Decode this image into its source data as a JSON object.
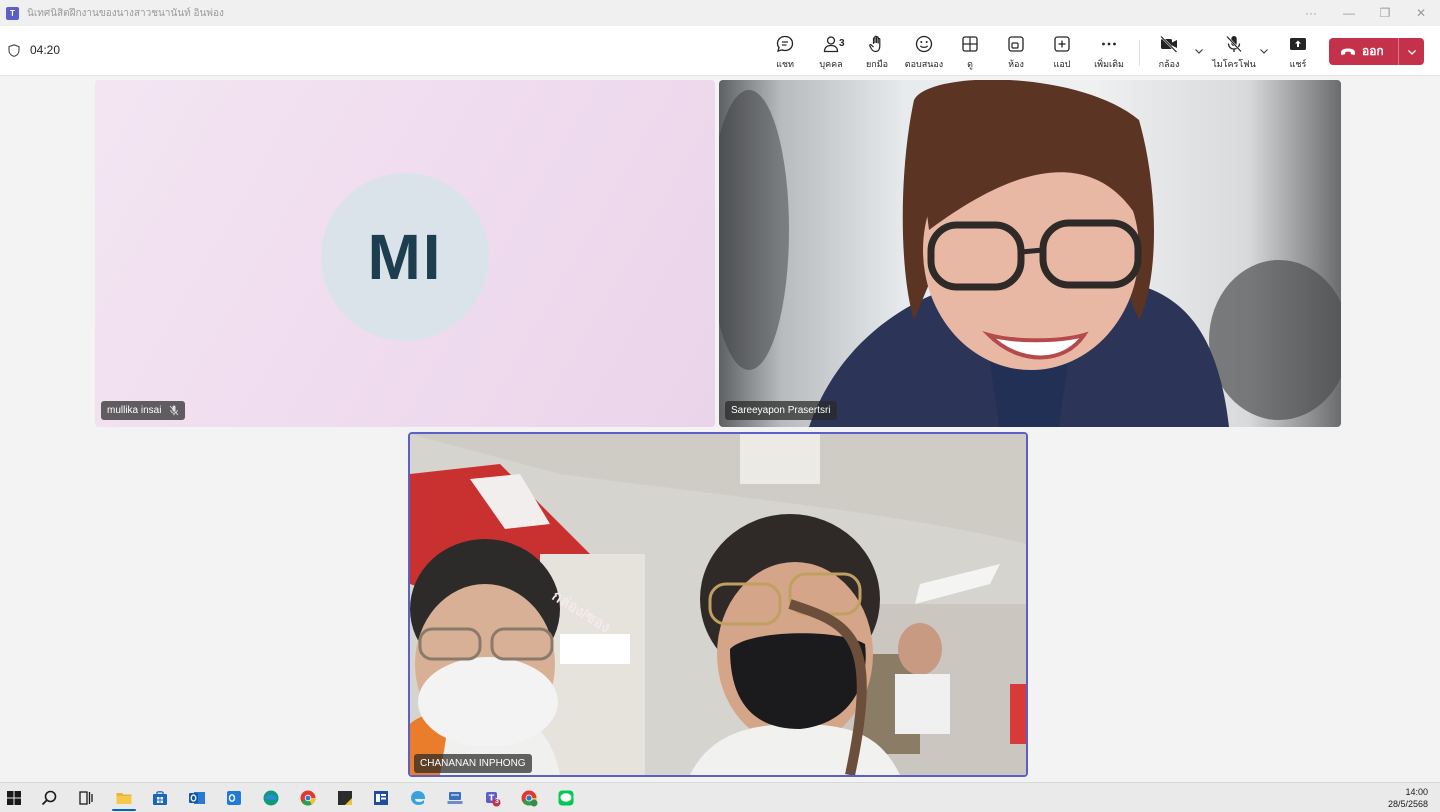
{
  "window": {
    "title": "นิเทศนิสิตฝึกงานของนางสาวชนานันท์ อินพ่อง",
    "controls": [
      "···",
      "—",
      "❐",
      "✕"
    ]
  },
  "meeting": {
    "timer": "04:20"
  },
  "toolbar": {
    "chat": {
      "label": "แชท",
      "icon": "chat-icon"
    },
    "people": {
      "label": "บุคคล",
      "count": "3",
      "icon": "people-icon"
    },
    "raise": {
      "label": "ยกมือ",
      "icon": "raise-hand-icon"
    },
    "react": {
      "label": "ตอบสนอง",
      "icon": "emoji-icon"
    },
    "view": {
      "label": "ดู",
      "icon": "grid-view-icon"
    },
    "rooms": {
      "label": "ห้อง",
      "icon": "rooms-icon"
    },
    "apps": {
      "label": "แอป",
      "icon": "add-app-icon"
    },
    "more": {
      "label": "เพิ่มเติม",
      "icon": "more-icon"
    },
    "camera": {
      "label": "กล้อง",
      "icon": "camera-off-icon"
    },
    "mic": {
      "label": "ไมโครโฟน",
      "icon": "mic-off-icon"
    },
    "share": {
      "label": "แชร์",
      "icon": "share-icon"
    },
    "leave": {
      "label": "ออก",
      "color": "#c4314b"
    }
  },
  "participants": [
    {
      "name": "mullika insai",
      "initials": "MI",
      "muted": true,
      "video": false
    },
    {
      "name": "Sareeyapon Prasertsri",
      "video": true
    },
    {
      "name": "CHANANAN INPHONG",
      "video": true,
      "active_speaker": true,
      "overlay_text": "กล่อง/ซอง"
    }
  ],
  "taskbar": {
    "icons": [
      "windows-start-icon",
      "search-icon",
      "task-view-icon",
      "file-explorer-icon",
      "store-icon",
      "outlook-icon",
      "outlook-new-icon",
      "edge-icon",
      "chrome-icon",
      "sticky-notes-icon",
      "word-icon",
      "edge-legacy-icon",
      "network-icon",
      "teams-icon",
      "chrome-profile-icon",
      "line-icon"
    ],
    "teams_badge": "3",
    "time": "14:00",
    "date": "28/5/2568"
  },
  "colors": {
    "accent": "#5b5fc7",
    "leave": "#c4314b"
  }
}
